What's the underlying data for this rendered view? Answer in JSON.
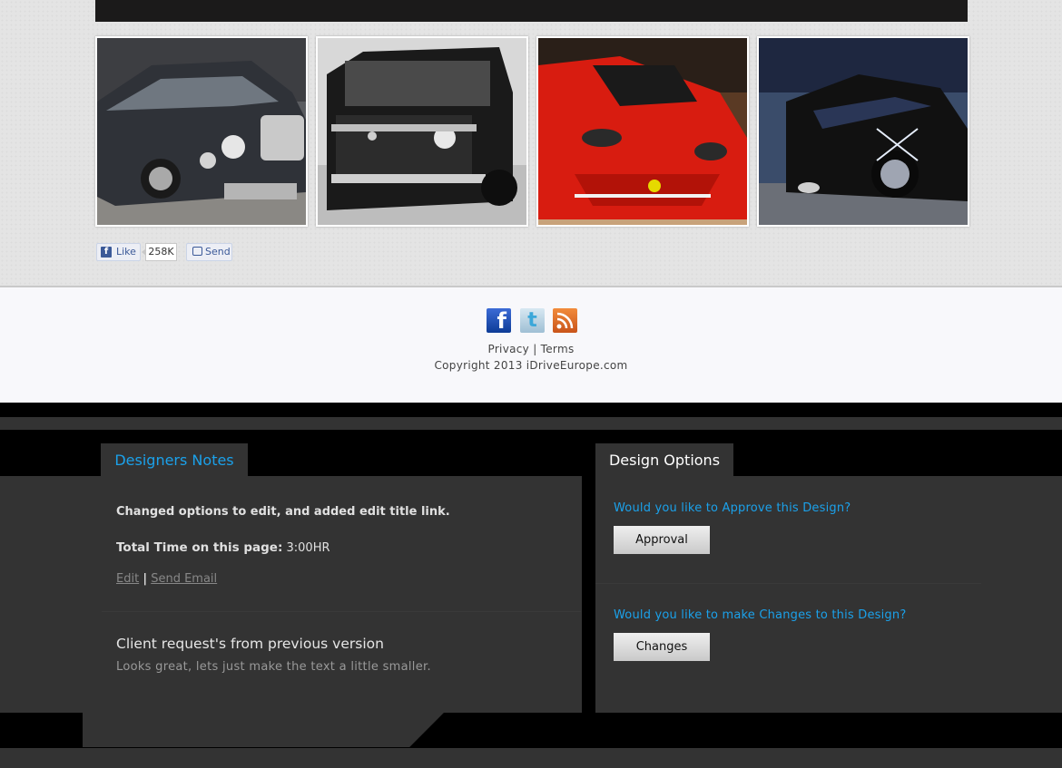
{
  "gallery": {
    "images": [
      {
        "name": "car-photo-bentley",
        "alt": "Grey sedan"
      },
      {
        "name": "car-photo-g-wagon",
        "alt": "Black SUV"
      },
      {
        "name": "car-photo-ferrari-red",
        "alt": "Red sports car"
      },
      {
        "name": "car-photo-ferrari-black",
        "alt": "Black convertible"
      }
    ]
  },
  "social_share": {
    "like_label": "Like",
    "like_count": "258K",
    "send_label": "Send",
    "like_icon": "facebook-f-icon",
    "send_icon": "send-bubble-icon"
  },
  "footer": {
    "icons": [
      "facebook-icon",
      "twitter-icon",
      "rss-icon"
    ],
    "privacy_label": "Privacy",
    "separator": "|",
    "terms_label": "Terms",
    "copyright": "Copyright 2013 iDriveEurope.com"
  },
  "notes_panel": {
    "tab_label": "Designers Notes",
    "note": "Changed options to edit, and added edit title link.",
    "time_label": "Total Time on this page:",
    "time_value": "3:00HR",
    "edit_label": "Edit",
    "link_separator": "|",
    "send_email_label": "Send Email",
    "request_title": "Client request's from previous version",
    "request_text": "Looks great, lets just make the text a little smaller."
  },
  "options_panel": {
    "tab_label": "Design Options",
    "approve_question": "Would you like to Approve this Design?",
    "approve_button": "Approval",
    "changes_question": "Would you like to make Changes to this Design?",
    "changes_button": "Changes"
  },
  "colors": {
    "accent": "#1ba1ea",
    "panel_bg": "#333333",
    "footer_bg": "#f8f8fb"
  }
}
